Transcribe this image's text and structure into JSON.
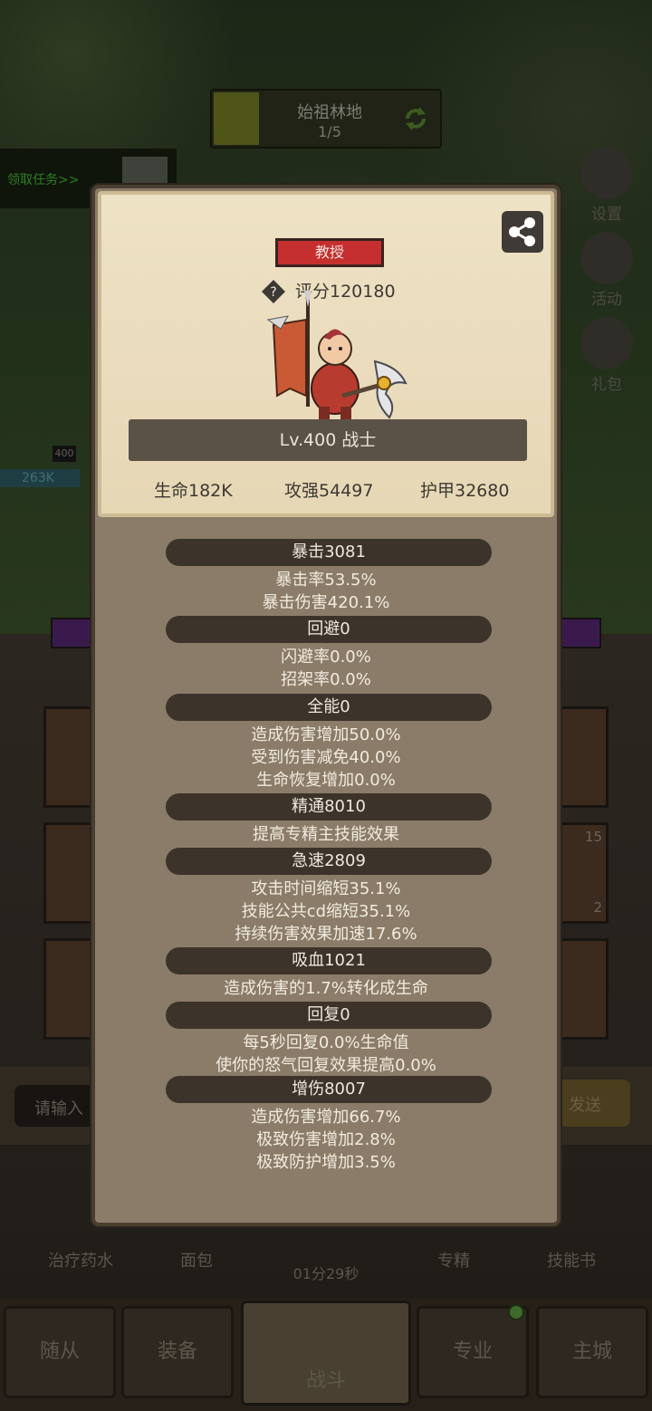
{
  "background": {
    "stage": {
      "title": "始祖林地",
      "progress": "1/5"
    },
    "quest_link": "领取任务>>",
    "side_buttons": [
      "设置",
      "活动",
      "礼包"
    ],
    "hp_label": "263K",
    "level_tag": "400",
    "chat": {
      "placeholder": "请输入",
      "send": "发送"
    },
    "bottom_items": [
      "治疗药水",
      "面包",
      "专精",
      "技能书"
    ],
    "timer": "01分29秒",
    "badge_counts": [
      "15",
      "2"
    ],
    "nav": [
      "随从",
      "装备",
      "战斗",
      "专业",
      "主城"
    ]
  },
  "modal": {
    "title_badge": "教授",
    "score": "评分120180",
    "level_line": "Lv.400 战士",
    "summary": {
      "hp": "生命182K",
      "attack": "攻强54497",
      "armor": "护甲32680"
    },
    "stat_groups": [
      {
        "header": "暴击3081",
        "lines": [
          "暴击率53.5%",
          "暴击伤害420.1%"
        ]
      },
      {
        "header": "回避0",
        "lines": [
          "闪避率0.0%",
          "招架率0.0%"
        ]
      },
      {
        "header": "全能0",
        "lines": [
          "造成伤害增加50.0%",
          "受到伤害减免40.0%",
          "生命恢复增加0.0%"
        ]
      },
      {
        "header": "精通8010",
        "lines": [
          "提高专精主技能效果"
        ]
      },
      {
        "header": "急速2809",
        "lines": [
          "攻击时间缩短35.1%",
          "技能公共cd缩短35.1%",
          "持续伤害效果加速17.6%"
        ]
      },
      {
        "header": "吸血1021",
        "lines": [
          "造成伤害的1.7%转化成生命"
        ]
      },
      {
        "header": "回复0",
        "lines": [
          "每5秒回复0.0%生命值",
          "使你的怒气回复效果提高0.0%"
        ]
      },
      {
        "header": "增伤8007",
        "lines": [
          "造成伤害增加66.7%",
          "极致伤害增加2.8%",
          "极致防护增加3.5%"
        ]
      }
    ]
  }
}
